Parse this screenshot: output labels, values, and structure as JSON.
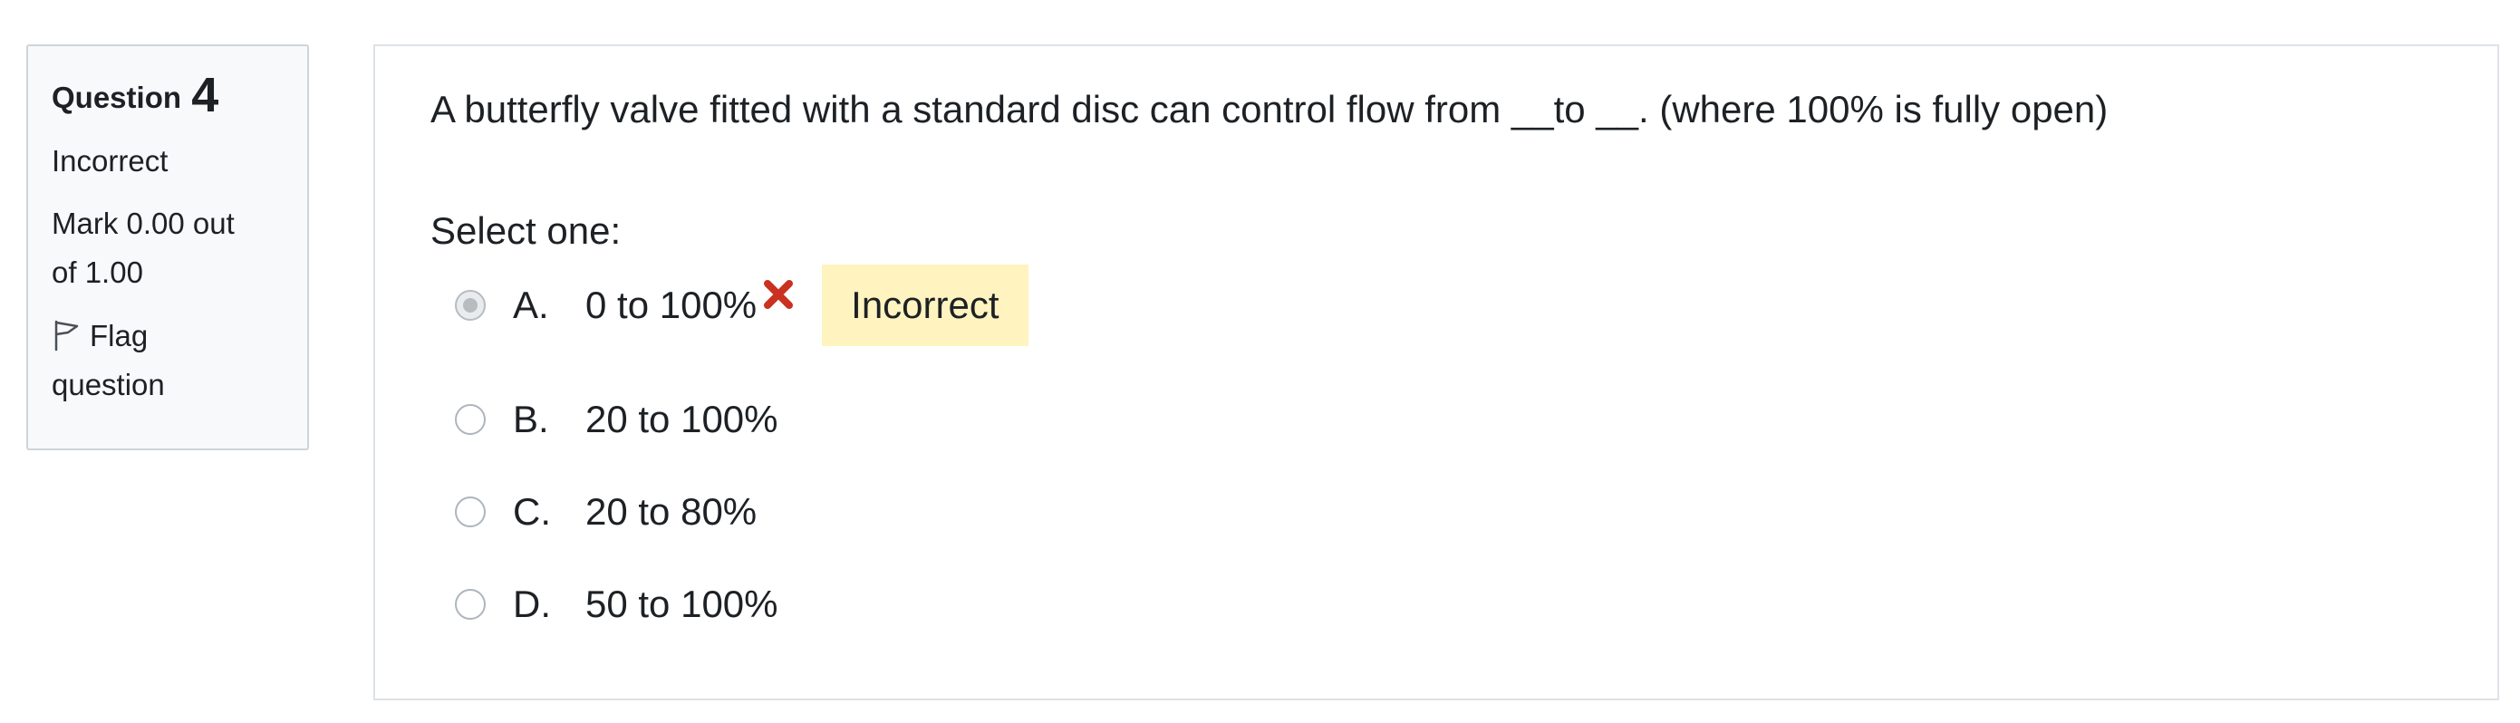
{
  "info": {
    "question_label": "Question",
    "question_number": "4",
    "state": "Incorrect",
    "grade_line1": "Mark 0.00 out",
    "grade_line2": "of 1.00",
    "flag_line1": "Flag",
    "flag_line2": "question",
    "flag_icon": "flag-outline-icon"
  },
  "question": {
    "text": "A butterfly valve fitted with a standard disc can control flow from __to __. (where 100% is fully open)",
    "prompt": "Select one:",
    "answers": [
      {
        "letter": "A.",
        "text": "0 to 100%",
        "selected": true
      },
      {
        "letter": "B.",
        "text": "20 to 100%",
        "selected": false
      },
      {
        "letter": "C.",
        "text": "20 to 80%",
        "selected": false
      },
      {
        "letter": "D.",
        "text": "50 to 100%",
        "selected": false
      }
    ],
    "feedback": "Incorrect",
    "incorrect_icon": "red-cross-icon"
  },
  "colors": {
    "feedback_bg": "#fff3bf",
    "incorrect_icon": "#ca3120",
    "info_bg": "#f8f9fa"
  }
}
